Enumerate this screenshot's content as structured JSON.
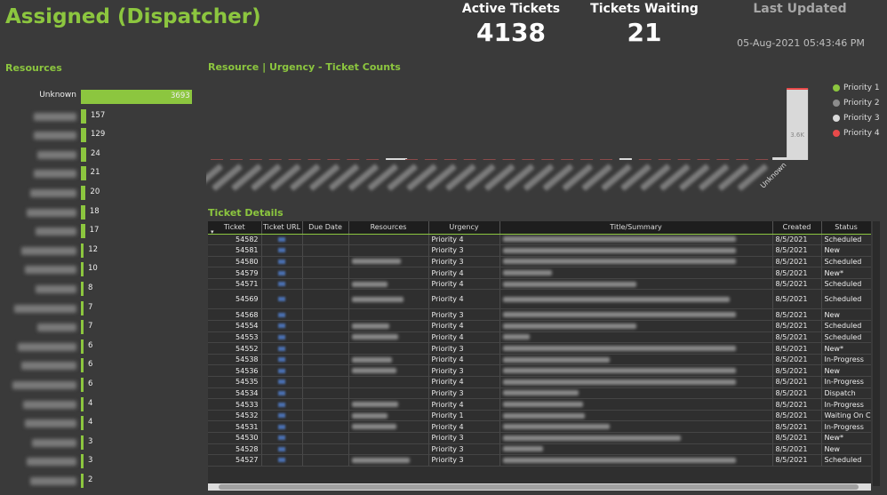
{
  "header": {
    "title": "Assigned (Dispatcher)",
    "active_label": "Active Tickets",
    "active_value": "4138",
    "waiting_label": "Tickets Waiting",
    "waiting_value": "21",
    "updated_label": "Last Updated",
    "updated_value": "05-Aug-2021 05:43:46 PM"
  },
  "resources": {
    "title": "Resources",
    "items": [
      {
        "label": "Unknown",
        "value": 3693
      },
      {
        "label": "",
        "value": 157
      },
      {
        "label": "",
        "value": 129
      },
      {
        "label": "",
        "value": 24
      },
      {
        "label": "",
        "value": 21
      },
      {
        "label": "",
        "value": 20
      },
      {
        "label": "",
        "value": 18
      },
      {
        "label": "",
        "value": 17
      },
      {
        "label": "",
        "value": 12
      },
      {
        "label": "",
        "value": 10
      },
      {
        "label": "",
        "value": 8
      },
      {
        "label": "",
        "value": 7
      },
      {
        "label": "",
        "value": 7
      },
      {
        "label": "",
        "value": 6
      },
      {
        "label": "",
        "value": 6
      },
      {
        "label": "",
        "value": 6
      },
      {
        "label": "",
        "value": 4
      },
      {
        "label": "",
        "value": 4
      },
      {
        "label": "",
        "value": 3
      },
      {
        "label": "",
        "value": 3
      },
      {
        "label": "",
        "value": 2
      }
    ]
  },
  "chart_data": {
    "type": "bar",
    "title": "Resource | Urgency - Ticket Counts",
    "categories": [
      "",
      "",
      "",
      "",
      "",
      "",
      "",
      "",
      "",
      "",
      "",
      "",
      "",
      "",
      "",
      "",
      "",
      "",
      "",
      "",
      "",
      "",
      "",
      "",
      "",
      "",
      "",
      "",
      "",
      "Unknown"
    ],
    "series": [
      {
        "name": "Priority 1",
        "color": "#8cc63f"
      },
      {
        "name": "Priority 2",
        "color": "#8c8c8c"
      },
      {
        "name": "Priority 3",
        "color": "#d9d9d9"
      },
      {
        "name": "Priority 4",
        "color": "#e84a4a"
      }
    ],
    "highlight_label": "3.6K",
    "highlight_value": 3600
  },
  "table": {
    "title": "Ticket Details",
    "columns": [
      "Ticket",
      "Ticket URL",
      "Due Date",
      "Resources",
      "Urgency",
      "Title/Summary",
      "Created",
      "Status"
    ],
    "rows": [
      [
        "54582",
        "Priority 4",
        "8/5/2021",
        "Scheduled"
      ],
      [
        "54581",
        "Priority 3",
        "8/5/2021",
        "New"
      ],
      [
        "54580",
        "Priority 3",
        "8/5/2021",
        "Scheduled"
      ],
      [
        "54579",
        "Priority 4",
        "8/5/2021",
        "New*"
      ],
      [
        "54571",
        "Priority 4",
        "8/5/2021",
        "Scheduled"
      ],
      [
        "54569",
        "Priority 4",
        "8/5/2021",
        "Scheduled"
      ],
      [
        "54568",
        "Priority 3",
        "8/5/2021",
        "New"
      ],
      [
        "54554",
        "Priority 4",
        "8/5/2021",
        "Scheduled"
      ],
      [
        "54553",
        "Priority 4",
        "8/5/2021",
        "Scheduled"
      ],
      [
        "54552",
        "Priority 3",
        "8/5/2021",
        "New*"
      ],
      [
        "54538",
        "Priority 4",
        "8/5/2021",
        "In-Progress"
      ],
      [
        "54536",
        "Priority 3",
        "8/5/2021",
        "New"
      ],
      [
        "54535",
        "Priority 4",
        "8/5/2021",
        "In-Progress"
      ],
      [
        "54534",
        "Priority 3",
        "8/5/2021",
        "Dispatch"
      ],
      [
        "54533",
        "Priority 4",
        "8/5/2021",
        "In-Progress"
      ],
      [
        "54532",
        "Priority 1",
        "8/5/2021",
        "Waiting On Cl"
      ],
      [
        "54531",
        "Priority 4",
        "8/5/2021",
        "In-Progress"
      ],
      [
        "54530",
        "Priority 3",
        "8/5/2021",
        "New*"
      ],
      [
        "54528",
        "Priority 3",
        "8/5/2021",
        "New"
      ],
      [
        "54527",
        "Priority 3",
        "8/5/2021",
        "Scheduled"
      ]
    ]
  }
}
